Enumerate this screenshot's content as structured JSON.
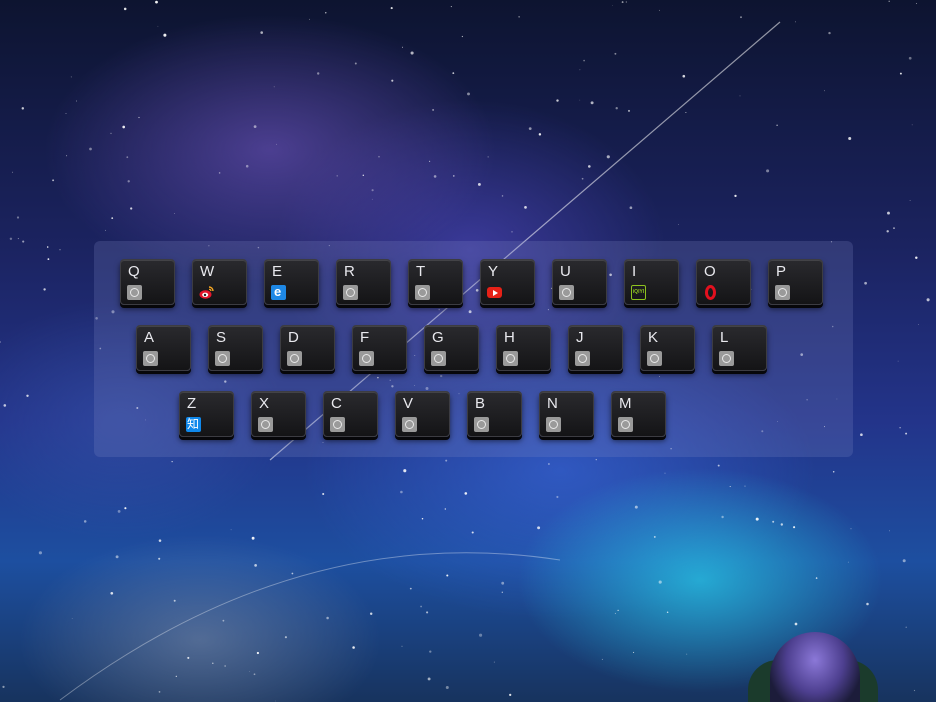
{
  "keyboard": {
    "rows": [
      [
        {
          "letter": "Q",
          "icon": "default-site-icon"
        },
        {
          "letter": "W",
          "icon": "weibo-icon"
        },
        {
          "letter": "E",
          "icon": "ie-icon"
        },
        {
          "letter": "R",
          "icon": "default-site-icon"
        },
        {
          "letter": "T",
          "icon": "default-site-icon"
        },
        {
          "letter": "Y",
          "icon": "youtube-icon"
        },
        {
          "letter": "U",
          "icon": "default-site-icon"
        },
        {
          "letter": "I",
          "icon": "iqiyi-icon"
        },
        {
          "letter": "O",
          "icon": "opera-icon"
        },
        {
          "letter": "P",
          "icon": "default-site-icon"
        }
      ],
      [
        {
          "letter": "A",
          "icon": "default-site-icon"
        },
        {
          "letter": "S",
          "icon": "default-site-icon"
        },
        {
          "letter": "D",
          "icon": "default-site-icon"
        },
        {
          "letter": "F",
          "icon": "default-site-icon"
        },
        {
          "letter": "G",
          "icon": "default-site-icon"
        },
        {
          "letter": "H",
          "icon": "default-site-icon"
        },
        {
          "letter": "J",
          "icon": "default-site-icon"
        },
        {
          "letter": "K",
          "icon": "default-site-icon"
        },
        {
          "letter": "L",
          "icon": "default-site-icon"
        }
      ],
      [
        {
          "letter": "Z",
          "icon": "zhihu-icon"
        },
        {
          "letter": "X",
          "icon": "default-site-icon"
        },
        {
          "letter": "C",
          "icon": "default-site-icon"
        },
        {
          "letter": "V",
          "icon": "default-site-icon"
        },
        {
          "letter": "B",
          "icon": "default-site-icon"
        },
        {
          "letter": "N",
          "icon": "default-site-icon"
        },
        {
          "letter": "M",
          "icon": "default-site-icon"
        }
      ]
    ]
  },
  "colors": {
    "key_background": "#1e1e22",
    "key_text": "#e9e9ee",
    "panel_tint": "#828cc8"
  }
}
